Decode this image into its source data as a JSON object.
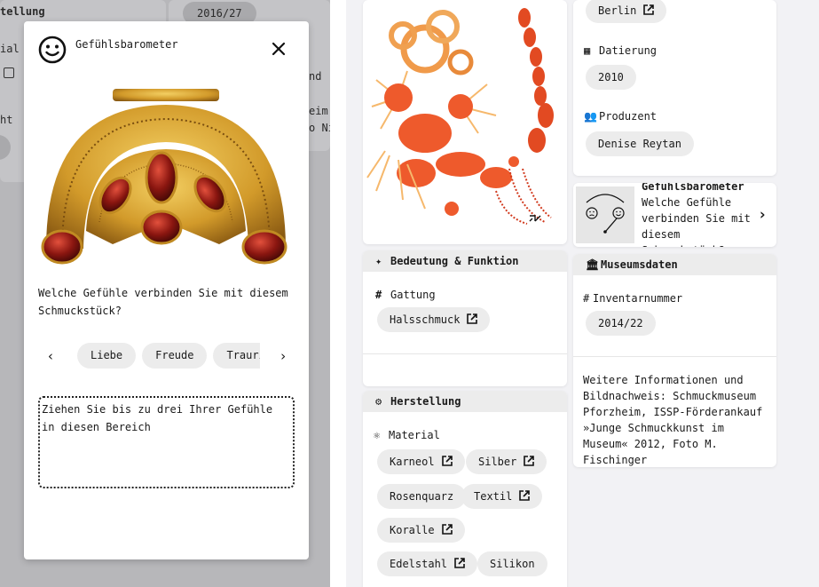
{
  "background": {
    "fragments": {
      "f1": "tellung",
      "f2": "ial",
      "f3": "ht",
      "chip_year": "2016/27",
      "f4": "nd",
      "f5": "eim,",
      "f6": "o Ni"
    }
  },
  "modal": {
    "title": "Gefühlsbarometer",
    "question": "Welche Gefühle verbinden Sie mit diesem Schmuckstück?",
    "emotions": [
      "Liebe",
      "Freude",
      "Traurigkeit"
    ],
    "dropzone_text": "Ziehen Sie bis zu drei Ihrer Gefühle in diesen Bereich"
  },
  "details_top": {
    "place_chip": "Berlin",
    "date_label": "Datierung",
    "date_value": "2010",
    "producer_label": "Produzent",
    "producer_value": "Denise Reytan"
  },
  "barometer_teaser": {
    "title": "Gefühlsbarometer",
    "text": "Welche Gefühle verbinden Sie mit diesem Schmuckstück?"
  },
  "meaning": {
    "header": "Bedeutung & Funktion",
    "genre_label": "Gattung",
    "genre_chip": "Halsschmuck"
  },
  "production": {
    "header": "Herstellung",
    "material_label": "Material",
    "materials": [
      "Karneol",
      "Silber",
      "Rosenquarz",
      "Textil",
      "Koralle",
      "Edelstahl",
      "Silikon"
    ]
  },
  "museum": {
    "header": "Museumsdaten",
    "inv_label": "Inventarnummer",
    "inv_value": "2014/22",
    "info": "Weitere Informationen und Bildnachweis: Schmuckmuseum Pforzheim, ISSP-Förderankauf »Junge Schmuckkunst im Museum« 2012, Foto M. Fischinger"
  },
  "colors": {
    "chip_bg": "#ececec",
    "page_bg": "#f2f2f5",
    "overlay": "#b7b7ba"
  }
}
